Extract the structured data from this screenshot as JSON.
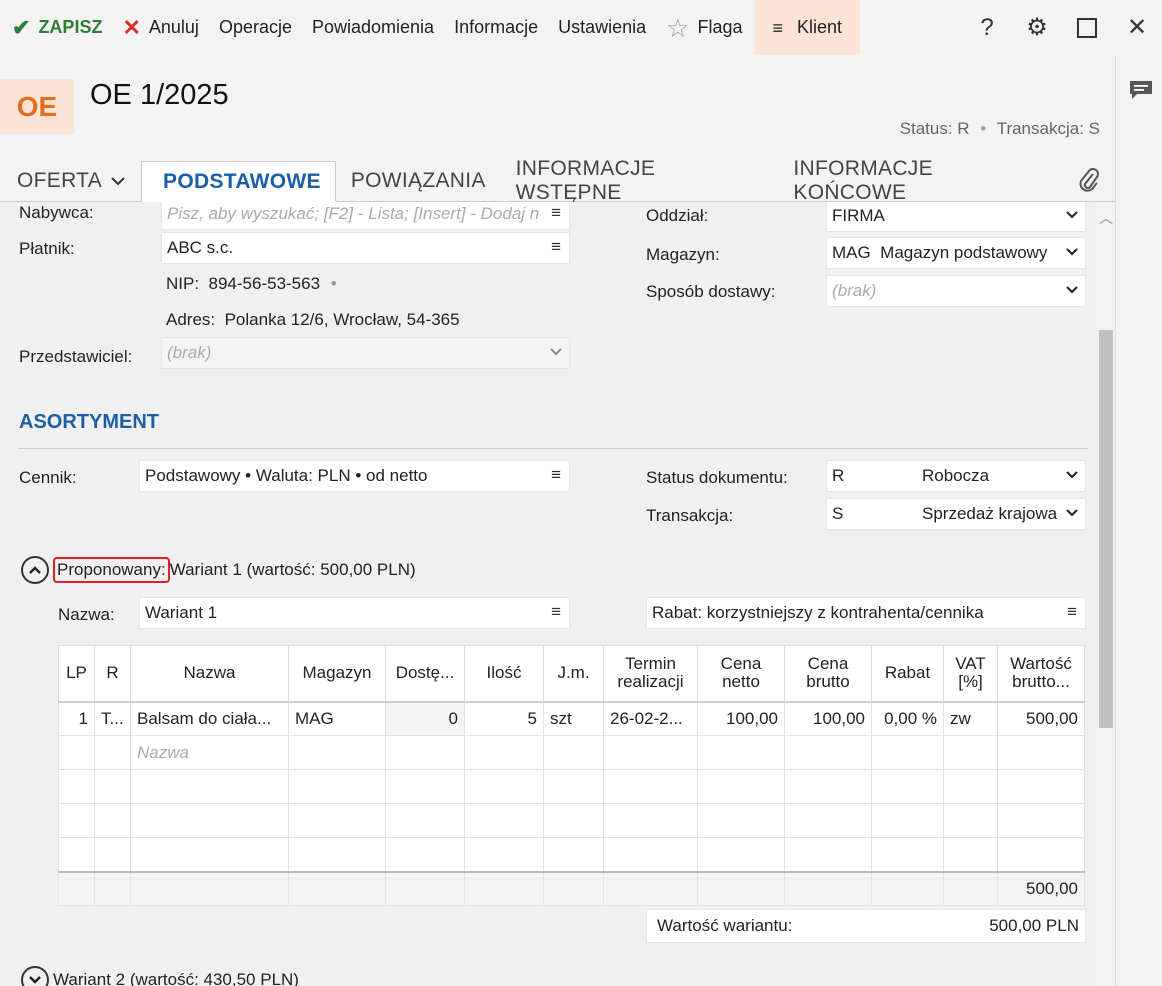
{
  "toolbar": {
    "save": "ZAPISZ",
    "cancel": "Anuluj",
    "operations": "Operacje",
    "notifications": "Powiadomienia",
    "information": "Informacje",
    "settings": "Ustawienia",
    "flag": "Flaga",
    "client": "Klient",
    "help": "?"
  },
  "header": {
    "badge": "OE",
    "title": "OE 1/2025",
    "status_label": "Status:",
    "status_value": "R",
    "transaction_label": "Transakcja:",
    "transaction_value": "S"
  },
  "tabs": [
    {
      "label": "OFERTA"
    },
    {
      "label": "PODSTAWOWE"
    },
    {
      "label": "POWIĄZANIA"
    },
    {
      "label": "INFORMACJE WSTĘPNE"
    },
    {
      "label": "INFORMACJE KOŃCOWE"
    }
  ],
  "form": {
    "buyer_label": "Nabywca:",
    "buyer_placeholder": "Pisz, aby wyszukać; [F2] - Lista; [Insert] - Dodaj n",
    "payer_label": "Płatnik:",
    "payer_value": "ABC s.c.",
    "nip_label": "NIP:",
    "nip_value": "894-56-53-563",
    "address_label": "Adres:",
    "address_value": "Polanka  12/6, Wrocław, 54-365",
    "rep_label": "Przedstawiciel:",
    "rep_value": "(brak)",
    "branch_label": "Oddział:",
    "branch_value": "FIRMA",
    "warehouse_label": "Magazyn:",
    "warehouse_value": "MAG  Magazyn podstawowy",
    "delivery_label": "Sposób dostawy:",
    "delivery_value": "(brak)"
  },
  "assortment": {
    "title": "ASORTYMENT",
    "pricelist_label": "Cennik:",
    "pricelist_value": "Podstawowy • Waluta: PLN • od netto",
    "docstatus_label": "Status dokumentu:",
    "docstatus_code": "R",
    "docstatus_value": "Robocza",
    "transaction_label": "Transakcja:",
    "transaction_code": "S",
    "transaction_value": "Sprzedaż krajowa"
  },
  "variant1": {
    "proposed_label": "Proponowany:",
    "heading": "Wariant 1 (wartość: 500,00 PLN)",
    "name_label": "Nazwa:",
    "name_value": "Wariant 1",
    "discount_text": "Rabat: korzystniejszy z kontrahenta/cennika",
    "value_label": "Wartość wariantu:",
    "value_amount": "500,00 PLN"
  },
  "grid": {
    "headers": [
      "LP",
      "R",
      "Nazwa",
      "Magazyn",
      "Dostę...",
      "Ilość",
      "J.m.",
      "Termin realizacji",
      "Cena netto",
      "Cena brutto",
      "Rabat",
      "VAT [%]",
      "Wartość brutto..."
    ],
    "row": [
      "1",
      "T...",
      "Balsam do ciała...",
      "MAG",
      "0",
      "5",
      "szt",
      "26-02-2...",
      "100,00",
      "100,00",
      "0,00 %",
      "zw",
      "500,00"
    ],
    "new_row_placeholder": "Nazwa",
    "sum_value": "500,00"
  },
  "variant2": {
    "heading": "Wariant 2 (wartość: 430,50 PLN)"
  }
}
